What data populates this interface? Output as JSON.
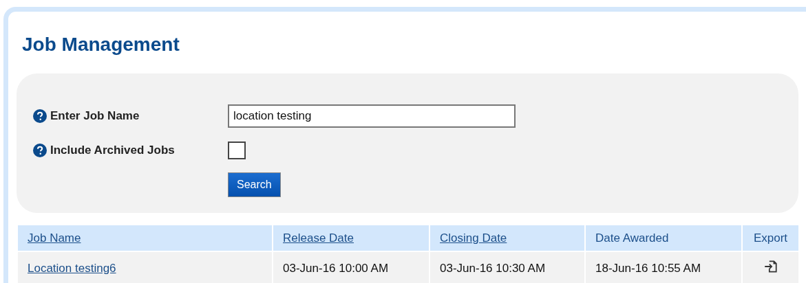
{
  "page": {
    "title": "Job Management"
  },
  "search_form": {
    "job_name_label": "Enter Job Name",
    "job_name_value": "location testing",
    "archived_label": "Include Archived Jobs",
    "archived_checked": false,
    "search_button": "Search"
  },
  "table": {
    "columns": [
      {
        "label": "Job Name",
        "kind": "link"
      },
      {
        "label": "Release Date",
        "kind": "link"
      },
      {
        "label": "Closing Date",
        "kind": "link"
      },
      {
        "label": "Date Awarded",
        "kind": "plain"
      },
      {
        "label": "Export",
        "kind": "plain"
      }
    ],
    "rows": [
      {
        "job_name": "Location testing6",
        "release_date": "03-Jun-16 10:00 AM",
        "closing_date": "03-Jun-16 10:30 AM",
        "date_awarded": "18-Jun-16 10:55 AM"
      }
    ]
  }
}
